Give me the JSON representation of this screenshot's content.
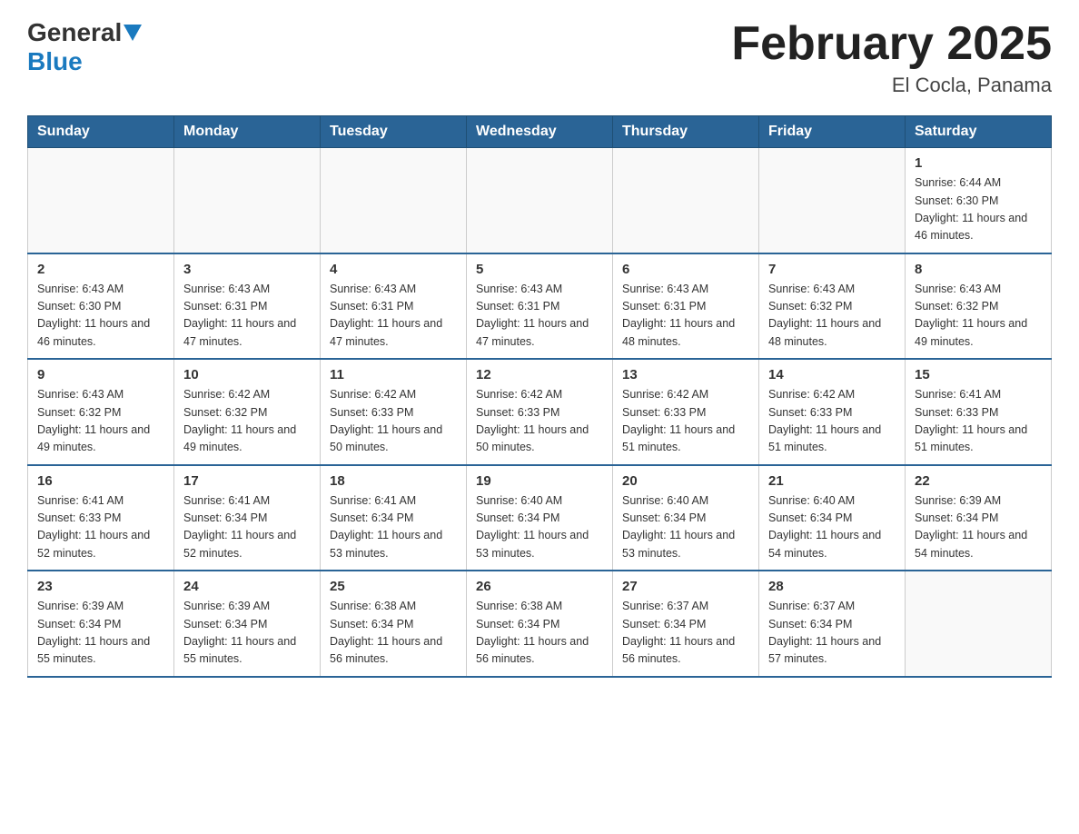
{
  "header": {
    "logo_general": "General",
    "logo_blue": "Blue",
    "title": "February 2025",
    "location": "El Cocla, Panama"
  },
  "days_of_week": [
    "Sunday",
    "Monday",
    "Tuesday",
    "Wednesday",
    "Thursday",
    "Friday",
    "Saturday"
  ],
  "weeks": [
    {
      "days": [
        {
          "num": "",
          "info": ""
        },
        {
          "num": "",
          "info": ""
        },
        {
          "num": "",
          "info": ""
        },
        {
          "num": "",
          "info": ""
        },
        {
          "num": "",
          "info": ""
        },
        {
          "num": "",
          "info": ""
        },
        {
          "num": "1",
          "info": "Sunrise: 6:44 AM\nSunset: 6:30 PM\nDaylight: 11 hours and 46 minutes."
        }
      ]
    },
    {
      "days": [
        {
          "num": "2",
          "info": "Sunrise: 6:43 AM\nSunset: 6:30 PM\nDaylight: 11 hours and 46 minutes."
        },
        {
          "num": "3",
          "info": "Sunrise: 6:43 AM\nSunset: 6:31 PM\nDaylight: 11 hours and 47 minutes."
        },
        {
          "num": "4",
          "info": "Sunrise: 6:43 AM\nSunset: 6:31 PM\nDaylight: 11 hours and 47 minutes."
        },
        {
          "num": "5",
          "info": "Sunrise: 6:43 AM\nSunset: 6:31 PM\nDaylight: 11 hours and 47 minutes."
        },
        {
          "num": "6",
          "info": "Sunrise: 6:43 AM\nSunset: 6:31 PM\nDaylight: 11 hours and 48 minutes."
        },
        {
          "num": "7",
          "info": "Sunrise: 6:43 AM\nSunset: 6:32 PM\nDaylight: 11 hours and 48 minutes."
        },
        {
          "num": "8",
          "info": "Sunrise: 6:43 AM\nSunset: 6:32 PM\nDaylight: 11 hours and 49 minutes."
        }
      ]
    },
    {
      "days": [
        {
          "num": "9",
          "info": "Sunrise: 6:43 AM\nSunset: 6:32 PM\nDaylight: 11 hours and 49 minutes."
        },
        {
          "num": "10",
          "info": "Sunrise: 6:42 AM\nSunset: 6:32 PM\nDaylight: 11 hours and 49 minutes."
        },
        {
          "num": "11",
          "info": "Sunrise: 6:42 AM\nSunset: 6:33 PM\nDaylight: 11 hours and 50 minutes."
        },
        {
          "num": "12",
          "info": "Sunrise: 6:42 AM\nSunset: 6:33 PM\nDaylight: 11 hours and 50 minutes."
        },
        {
          "num": "13",
          "info": "Sunrise: 6:42 AM\nSunset: 6:33 PM\nDaylight: 11 hours and 51 minutes."
        },
        {
          "num": "14",
          "info": "Sunrise: 6:42 AM\nSunset: 6:33 PM\nDaylight: 11 hours and 51 minutes."
        },
        {
          "num": "15",
          "info": "Sunrise: 6:41 AM\nSunset: 6:33 PM\nDaylight: 11 hours and 51 minutes."
        }
      ]
    },
    {
      "days": [
        {
          "num": "16",
          "info": "Sunrise: 6:41 AM\nSunset: 6:33 PM\nDaylight: 11 hours and 52 minutes."
        },
        {
          "num": "17",
          "info": "Sunrise: 6:41 AM\nSunset: 6:34 PM\nDaylight: 11 hours and 52 minutes."
        },
        {
          "num": "18",
          "info": "Sunrise: 6:41 AM\nSunset: 6:34 PM\nDaylight: 11 hours and 53 minutes."
        },
        {
          "num": "19",
          "info": "Sunrise: 6:40 AM\nSunset: 6:34 PM\nDaylight: 11 hours and 53 minutes."
        },
        {
          "num": "20",
          "info": "Sunrise: 6:40 AM\nSunset: 6:34 PM\nDaylight: 11 hours and 53 minutes."
        },
        {
          "num": "21",
          "info": "Sunrise: 6:40 AM\nSunset: 6:34 PM\nDaylight: 11 hours and 54 minutes."
        },
        {
          "num": "22",
          "info": "Sunrise: 6:39 AM\nSunset: 6:34 PM\nDaylight: 11 hours and 54 minutes."
        }
      ]
    },
    {
      "days": [
        {
          "num": "23",
          "info": "Sunrise: 6:39 AM\nSunset: 6:34 PM\nDaylight: 11 hours and 55 minutes."
        },
        {
          "num": "24",
          "info": "Sunrise: 6:39 AM\nSunset: 6:34 PM\nDaylight: 11 hours and 55 minutes."
        },
        {
          "num": "25",
          "info": "Sunrise: 6:38 AM\nSunset: 6:34 PM\nDaylight: 11 hours and 56 minutes."
        },
        {
          "num": "26",
          "info": "Sunrise: 6:38 AM\nSunset: 6:34 PM\nDaylight: 11 hours and 56 minutes."
        },
        {
          "num": "27",
          "info": "Sunrise: 6:37 AM\nSunset: 6:34 PM\nDaylight: 11 hours and 56 minutes."
        },
        {
          "num": "28",
          "info": "Sunrise: 6:37 AM\nSunset: 6:34 PM\nDaylight: 11 hours and 57 minutes."
        },
        {
          "num": "",
          "info": ""
        }
      ]
    }
  ]
}
